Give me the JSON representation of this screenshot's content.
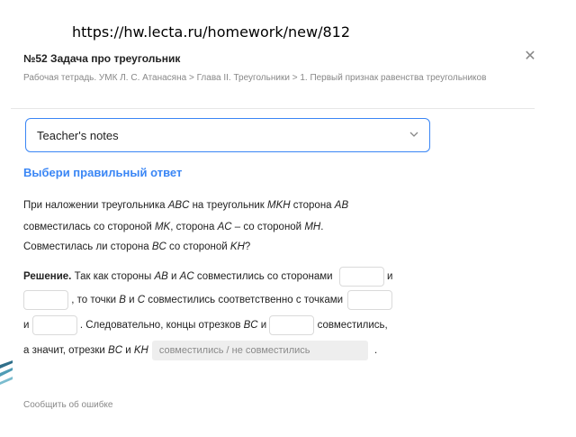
{
  "browser": {
    "url": "https://hw.lecta.ru/homework/new/812"
  },
  "header": {
    "title": "№52 Задача про треугольник",
    "breadcrumb": "Рабочая тетрадь. УМК Л. С. Атанасяна > Глава II. Треугольники > 1. Первый признак равенства треугольников",
    "close_icon": "close-icon"
  },
  "notes": {
    "label": "Teacher's notes",
    "icon": "chevron-down-icon"
  },
  "task": {
    "heading": "Выбери правильный ответ",
    "p1_a": "При наложении треугольника ",
    "p1_abc": "ABC",
    "p1_b": " на треугольник ",
    "p1_mkn": "MKH",
    "p1_c": " сторона ",
    "p1_ab": "AB",
    "p2_a": "совместилась со стороной ",
    "p2_mk": "MK",
    "p2_b": ", сторона ",
    "p2_ac": "AC",
    "p2_c": " – со стороной ",
    "p2_mh": "MH",
    "p2_d": ".",
    "p3_a": "Совместилась ли сторона ",
    "p3_bc": "BC",
    "p3_b": " со стороной ",
    "p3_kh": "KH",
    "p3_c": "?",
    "sol_label": "Решение.",
    "s1_a": " Так как стороны ",
    "s1_ab": "AB",
    "s1_and": " и ",
    "s1_ac": "AC",
    "s1_b": " совместились со сторонами ",
    "s1_c": " и",
    "s2_a": " , то точки ",
    "s2_b": "B",
    "s2_and": " и ",
    "s2_c": "C",
    "s2_d": " совместились соответственно с точками ",
    "s3_a": "и ",
    "s3_b": " . Следовательно, концы отрезков ",
    "s3_bc": "BC",
    "s3_and": " и ",
    "s3_c": " совместились,",
    "s4_a": "а значит, отрезки ",
    "s4_bc": "BC",
    "s4_and": " и ",
    "s4_kh": "KH",
    "s4_select_placeholder": "совместились / не совместились",
    "s4_end": " ."
  },
  "footer": {
    "report": "Сообщить об ошибке"
  }
}
